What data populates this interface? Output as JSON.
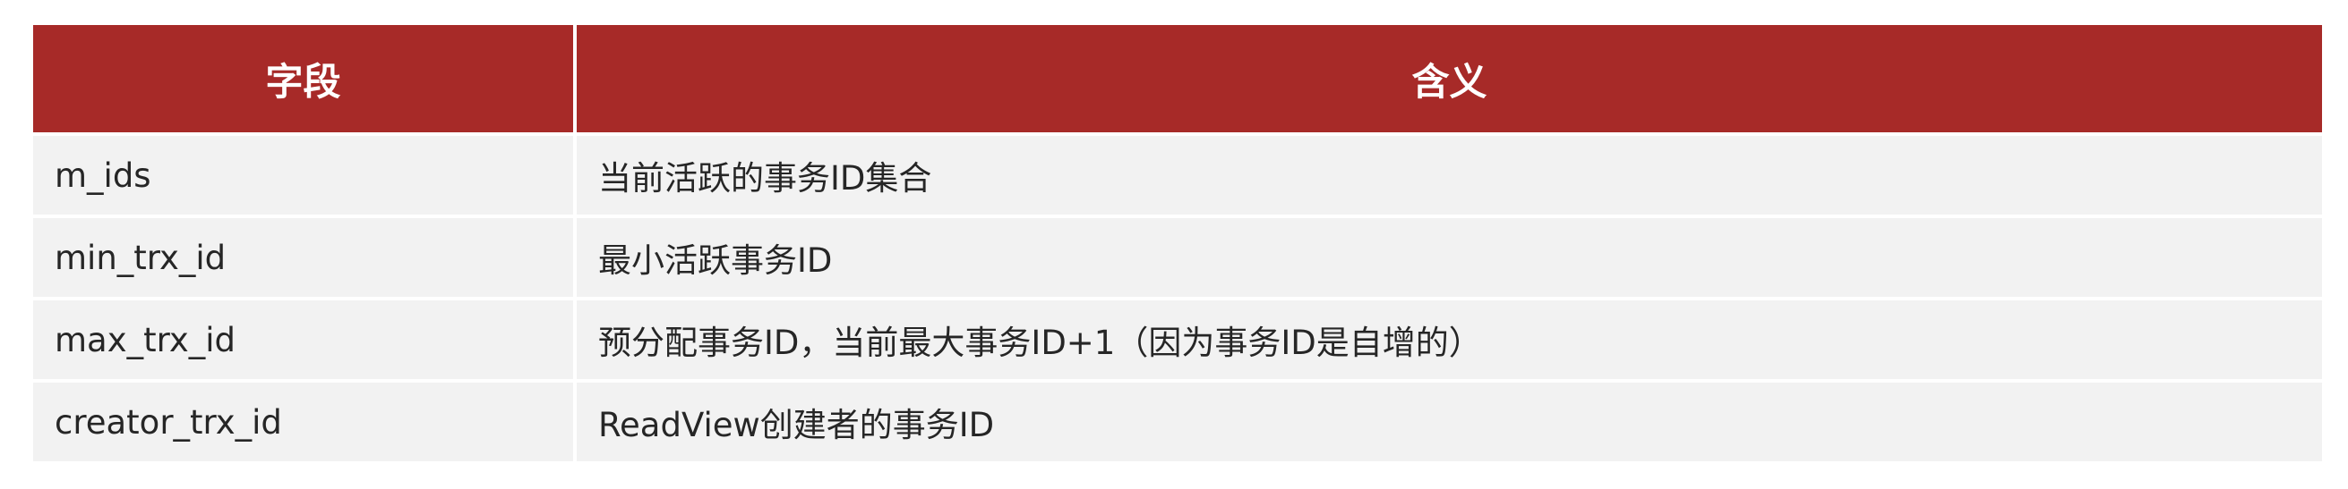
{
  "table": {
    "headers": [
      "字段",
      "含义"
    ],
    "rows": [
      {
        "field": "m_ids",
        "meaning": "当前活跃的事务ID集合"
      },
      {
        "field": "min_trx_id",
        "meaning": "最小活跃事务ID"
      },
      {
        "field": "max_trx_id",
        "meaning": "预分配事务ID，当前最大事务ID+1（因为事务ID是自增的）"
      },
      {
        "field": "creator_trx_id",
        "meaning": "ReadView创建者的事务ID"
      }
    ]
  },
  "colors": {
    "header_bg": "#a72a28",
    "header_text": "#ffffff",
    "row_bg": "#f2f2f2",
    "row_text": "#262626"
  }
}
